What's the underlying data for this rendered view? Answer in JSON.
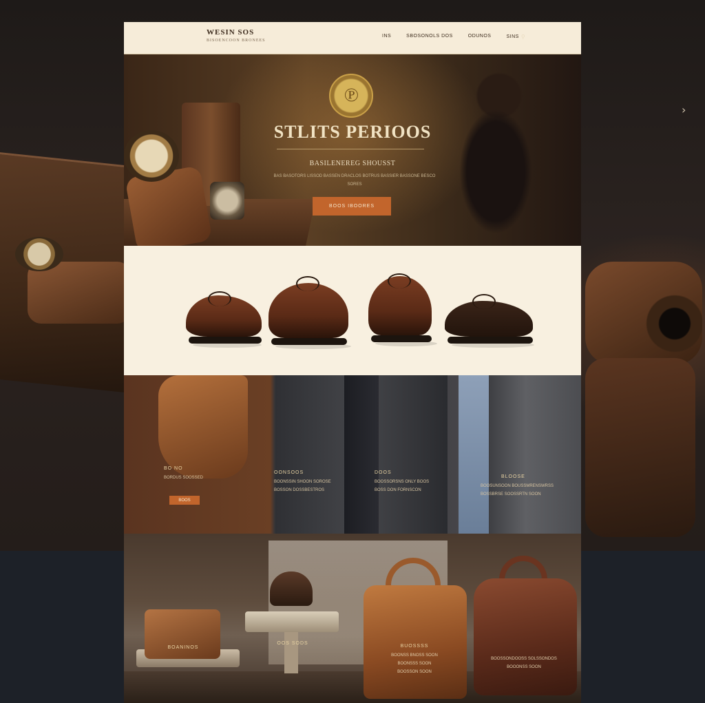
{
  "header": {
    "logo_title": "WESIN SOS",
    "logo_sub": "BISOENCOON BRONEES",
    "nav": [
      "INS",
      "SBOSONOLS DOS",
      "ODUNOS",
      "SINS"
    ]
  },
  "hero": {
    "title": "STLITS PERIOOS",
    "subtitle": "BASILENEREG SHOUSST",
    "desc_1": "BAS BASOTORS LISSOD BASSEN DRACLOS BOTRUS BASSIER BASSONE BESCO",
    "desc_2": "SORES",
    "cta": "BOOS IBOORES"
  },
  "apparel": {
    "block1": {
      "title": "BO NO",
      "line1": "BORDUS SOOSSED",
      "button": "BOOS"
    },
    "block2": {
      "title": "OONSOOS",
      "line1": "BOONSSIN SHOON SOROSE",
      "line2": "BOSSON DOSSBESTROS"
    },
    "block3": {
      "title": "DOOS",
      "line1": "BOOSSORSNS ONLY BOOS",
      "line2": "BOSS DON FORNSCON"
    },
    "block4": {
      "title": "BLOOSE",
      "line1": "BOOSUNSOON BOUSSMRENSWRSS",
      "line2": "BOSSBRSE SOOSSRTN SOON"
    }
  },
  "bags": {
    "bag1_title": "BOANINOS",
    "bag2_title": "OOS SODS",
    "bag3_title": "BUOSSSS",
    "bag3_line1": "BOONSS BNOSS SOON",
    "bag3_line2": "BOONSSS SOON",
    "bag3_line3": "BOOSSON SOON",
    "bag4_line1": "BOOSSONDOOSS SOLSSONDOS",
    "bag4_line2": "BOOONSS SOON"
  },
  "icons": {
    "search": "search-icon",
    "next": "chevron-right-icon"
  },
  "colors": {
    "accent": "#c2652c",
    "header_bg": "#f6ecd9",
    "text_light": "#eadcc0"
  }
}
